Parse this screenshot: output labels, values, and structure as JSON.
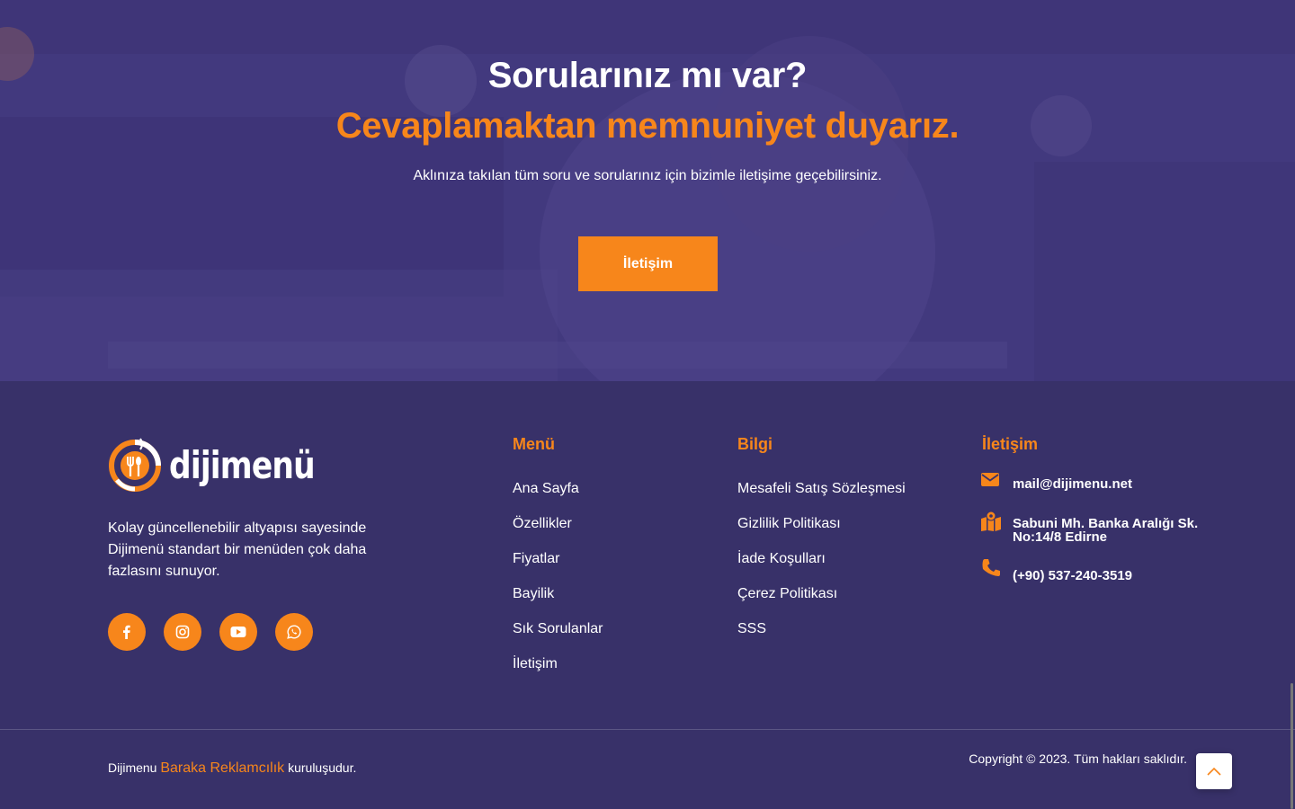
{
  "hero": {
    "title": "Sorularınız mı var?",
    "subtitle": "Cevaplamaktan memnuniyet duyarız.",
    "description": "Aklınıza takılan tüm soru ve sorularınız için bizimle iletişime geçebilirsiniz.",
    "button_label": "İletişim"
  },
  "footer": {
    "brand": "dijimenü",
    "about": "Kolay güncellenebilir altyapısı sayesinde Dijimenü standart bir menüden çok daha fazlasını sunuyor.",
    "socials": [
      {
        "icon": "facebook-icon"
      },
      {
        "icon": "instagram-icon"
      },
      {
        "icon": "youtube-icon"
      },
      {
        "icon": "whatsapp-icon"
      }
    ],
    "menu": {
      "title": "Menü",
      "items": [
        "Ana Sayfa",
        "Özellikler",
        "Fiyatlar",
        "Bayilik",
        "Sık Sorulanlar",
        "İletişim"
      ]
    },
    "info": {
      "title": "Bilgi",
      "items": [
        "Mesafeli Satış Sözleşmesi",
        "Gizlilik Politikası",
        "İade Koşulları",
        "Çerez Politikası",
        "SSS"
      ]
    },
    "contact": {
      "title": "İletişim",
      "email": "mail@dijimenu.net",
      "address_line1": "Sabuni Mh. Banka Aralığı Sk.",
      "address_line2": "No:14/8 Edirne",
      "phone": "(+90) 537-240-3519"
    },
    "bottom": {
      "prefix": "Dijimenu",
      "company": "Baraka Reklamcılık",
      "suffix": "kuruluşudur.",
      "copyright": "Copyright © 2023. Tüm hakları saklıdır."
    }
  },
  "colors": {
    "accent": "#f7861b",
    "background": "#383169",
    "hero_overlay": "#4a4185"
  }
}
